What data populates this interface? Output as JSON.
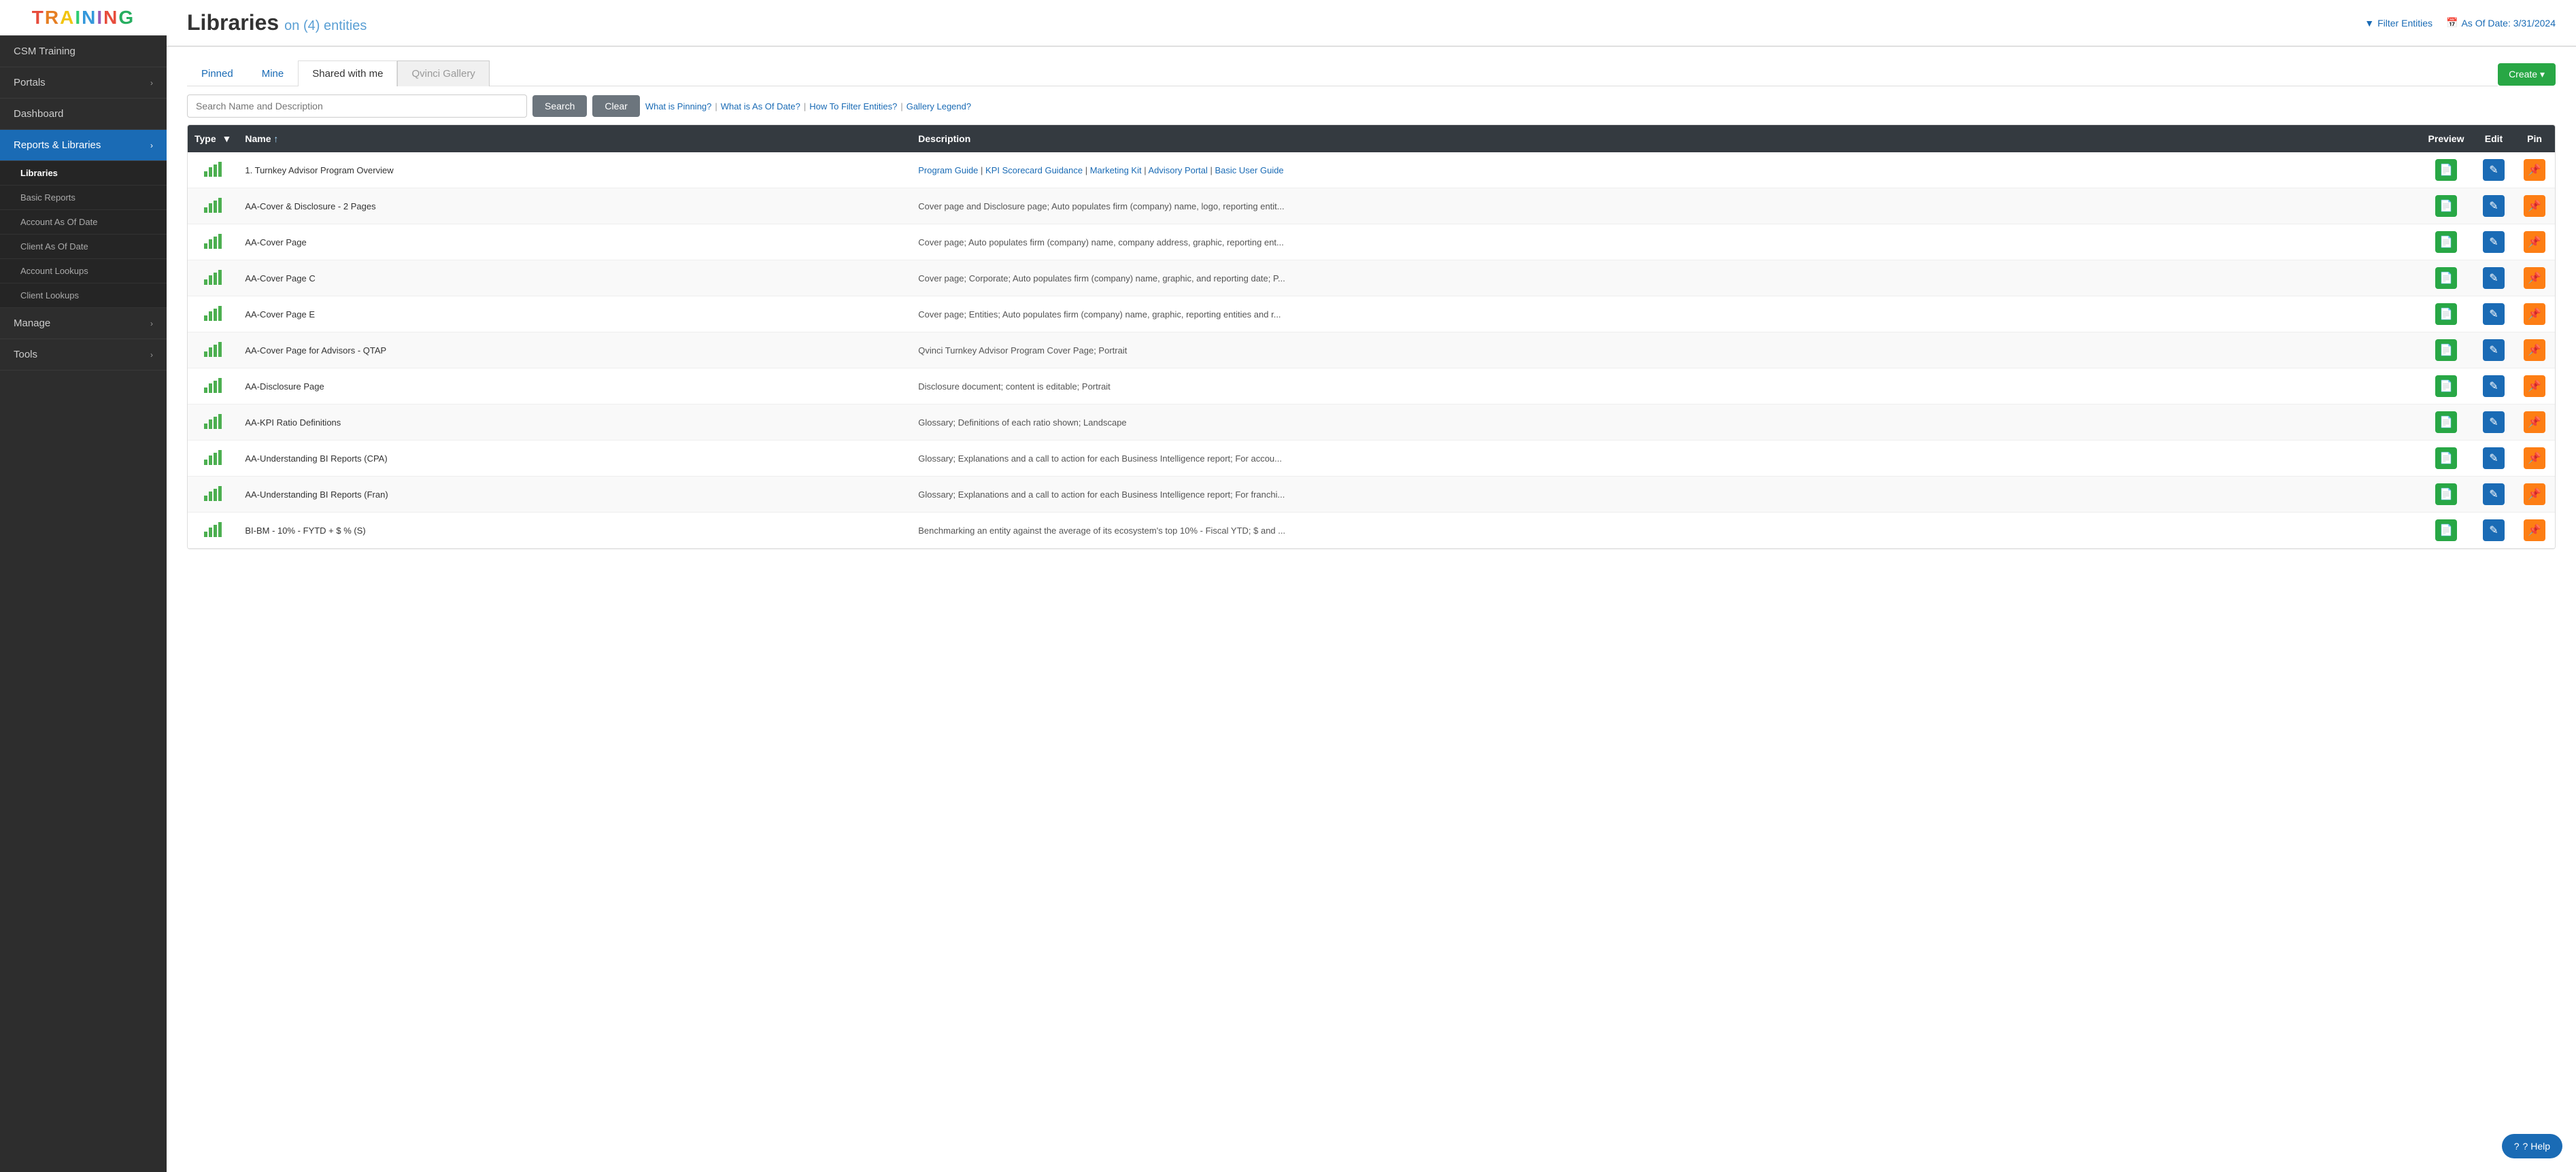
{
  "app": {
    "logo_letters": [
      "T",
      "R",
      "A",
      "I",
      "N",
      "I",
      "N",
      "G"
    ],
    "logo_colors": [
      "#e74c3c",
      "#e67e22",
      "#f1c40f",
      "#2ecc71",
      "#3498db",
      "#9b59b6",
      "#e74c3c",
      "#27ae60"
    ]
  },
  "sidebar": {
    "top_label": "CSM Training",
    "items": [
      {
        "id": "portals",
        "label": "Portals",
        "has_arrow": true
      },
      {
        "id": "dashboard",
        "label": "Dashboard",
        "has_arrow": false
      },
      {
        "id": "reports",
        "label": "Reports & Libraries",
        "has_arrow": true,
        "active": true
      },
      {
        "id": "manage",
        "label": "Manage",
        "has_arrow": true
      },
      {
        "id": "tools",
        "label": "Tools",
        "has_arrow": true
      }
    ],
    "sub_items": [
      {
        "id": "libraries",
        "label": "Libraries",
        "active": true
      },
      {
        "id": "basic-reports",
        "label": "Basic Reports",
        "active": false
      },
      {
        "id": "account-as-of-date",
        "label": "Account As Of Date",
        "active": false
      },
      {
        "id": "client-as-of-date",
        "label": "Client As Of Date",
        "active": false
      },
      {
        "id": "account-lookups",
        "label": "Account Lookups",
        "active": false
      },
      {
        "id": "client-lookups",
        "label": "Client Lookups",
        "active": false
      }
    ]
  },
  "header": {
    "title": "Libraries",
    "subtitle": "on (4) entities",
    "filter_label": "Filter Entities",
    "as_of_label": "As Of Date: 3/31/2024"
  },
  "tabs": [
    {
      "id": "pinned",
      "label": "Pinned",
      "state": "link"
    },
    {
      "id": "mine",
      "label": "Mine",
      "state": "link"
    },
    {
      "id": "shared",
      "label": "Shared with me",
      "state": "active"
    },
    {
      "id": "gallery",
      "label": "Qvinci Gallery",
      "state": "inactive"
    }
  ],
  "create_button": "Create ▾",
  "search": {
    "placeholder": "Search Name and Description",
    "search_label": "Search",
    "clear_label": "Clear"
  },
  "help_links": [
    {
      "id": "pinning",
      "label": "What is Pinning?"
    },
    {
      "id": "as-of-date",
      "label": "What is As Of Date?"
    },
    {
      "id": "filter",
      "label": "How To Filter Entities?"
    },
    {
      "id": "legend",
      "label": "Gallery Legend?"
    }
  ],
  "table": {
    "headers": [
      {
        "id": "type",
        "label": "Type"
      },
      {
        "id": "name",
        "label": "Name ↑"
      },
      {
        "id": "description",
        "label": "Description"
      },
      {
        "id": "preview",
        "label": "Preview"
      },
      {
        "id": "edit",
        "label": "Edit"
      },
      {
        "id": "pin",
        "label": "Pin"
      }
    ],
    "rows": [
      {
        "name": "1. Turnkey Advisor Program Overview",
        "description": "",
        "desc_links": [
          "Program Guide",
          "KPI Scorecard Guidance",
          "Marketing Kit",
          "Advisory Portal",
          "Basic User Guide"
        ],
        "is_links": true
      },
      {
        "name": "AA-Cover & Disclosure - 2 Pages",
        "description": "Cover page and Disclosure page; Auto populates firm (company) name, logo, reporting entit...",
        "is_links": false
      },
      {
        "name": "AA-Cover Page",
        "description": "Cover page; Auto populates firm (company) name, company address, graphic, reporting ent...",
        "is_links": false
      },
      {
        "name": "AA-Cover Page C",
        "description": "Cover page; Corporate; Auto populates firm (company) name, graphic, and reporting date; P...",
        "is_links": false
      },
      {
        "name": "AA-Cover Page E",
        "description": "Cover page; Entities; Auto populates firm (company) name, graphic, reporting entities and r...",
        "is_links": false
      },
      {
        "name": "AA-Cover Page for Advisors - QTAP",
        "description": "Qvinci Turnkey Advisor Program Cover Page; Portrait",
        "is_links": false
      },
      {
        "name": "AA-Disclosure Page",
        "description": "Disclosure document; content is editable; Portrait",
        "is_links": false
      },
      {
        "name": "AA-KPI Ratio Definitions",
        "description": "Glossary; Definitions of each ratio shown; Landscape",
        "is_links": false
      },
      {
        "name": "AA-Understanding BI Reports (CPA)",
        "description": "Glossary; Explanations and a call to action for each Business Intelligence report; For accou...",
        "is_links": false
      },
      {
        "name": "AA-Understanding BI Reports (Fran)",
        "description": "Glossary; Explanations and a call to action for each Business Intelligence report; For franchi...",
        "is_links": false
      },
      {
        "name": "BI-BM - 10% - FYTD + $ % (S)",
        "description": "Benchmarking an entity against the average of its ecosystem's top 10% - Fiscal YTD; $ and ...",
        "is_links": false
      }
    ]
  },
  "help_button": "? Help"
}
